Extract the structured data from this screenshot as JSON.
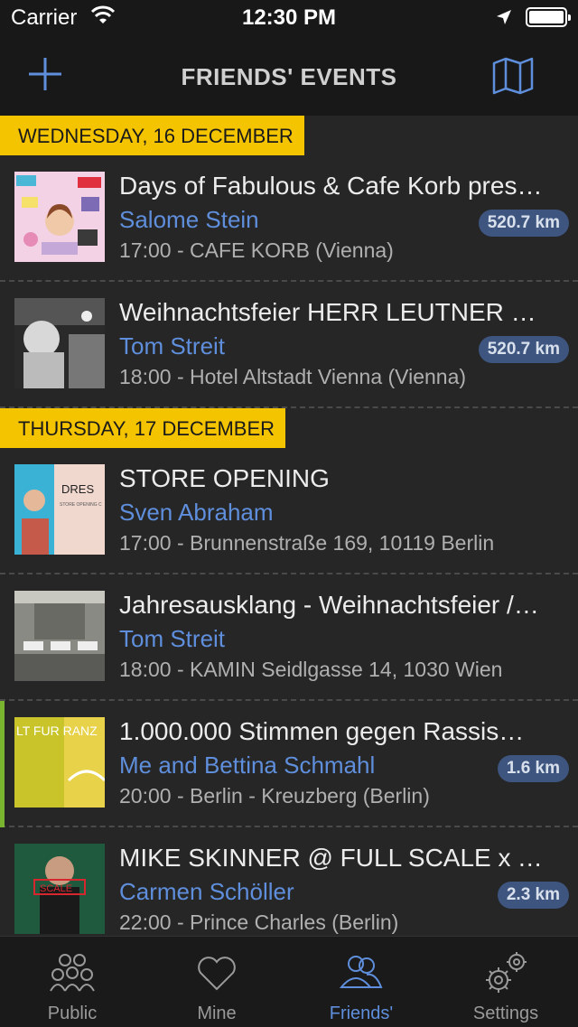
{
  "status_bar": {
    "carrier": "Carrier",
    "time": "12:30 PM"
  },
  "nav": {
    "title": "FRIENDS' EVENTS",
    "add_icon": "plus-icon",
    "map_icon": "map-icon"
  },
  "sections": [
    {
      "header": "WEDNESDAY, 16 DECEMBER",
      "events": [
        {
          "title": "Days of Fabulous & Cafe Korb presen...",
          "friend": "Salome Stein",
          "time_place": "17:00 - CAFE KORB (Vienna)",
          "distance": "520.7 km"
        },
        {
          "title": "Weihnachtsfeier HERR LEUTNER & E...",
          "friend": "Tom Streit",
          "time_place": "18:00 - Hotel Altstadt Vienna (Vienna)",
          "distance": "520.7 km"
        }
      ]
    },
    {
      "header": "THURSDAY, 17 DECEMBER",
      "events": [
        {
          "title": "STORE OPENING",
          "friend": "Sven Abraham",
          "time_place": "17:00 - Brunnenstraße 169, 10119 Berlin",
          "distance": "",
          "thumb_text": "DRES",
          "thumb_subtext": "STORE OPENING C"
        },
        {
          "title": "Jahresausklang - Weihnachtsfeier / Fi...",
          "friend": "Tom Streit",
          "time_place": "18:00 - KAMIN Seidlgasse 14, 1030 Wien",
          "distance": ""
        },
        {
          "title": "1.000.000 Stimmen gegen Rassismu...",
          "friend": "Me and Bettina Schmahl",
          "time_place": "20:00 - Berlin - Kreuzberg (Berlin)",
          "distance": "1.6 km",
          "thumb_text": "LT FUR RANZ"
        },
        {
          "title": "MIKE SKINNER @ FULL SCALE x TM...",
          "friend": "Carmen Schöller",
          "time_place": "22:00 - Prince Charles (Berlin)",
          "distance": "2.3 km",
          "thumb_text": "SCALE"
        }
      ]
    }
  ],
  "tabs": [
    {
      "label": "Public",
      "icon": "people-group-icon"
    },
    {
      "label": "Mine",
      "icon": "heart-icon"
    },
    {
      "label": "Friends'",
      "icon": "friends-icon",
      "active": true
    },
    {
      "label": "Settings",
      "icon": "gears-icon"
    }
  ],
  "colors": {
    "accent_yellow": "#f5c400",
    "link_blue": "#5f8fdc",
    "badge_bg": "#3e5580",
    "row_accent_green": "#7ab530"
  }
}
